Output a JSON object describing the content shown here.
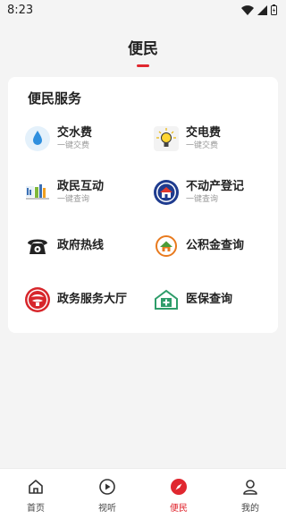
{
  "status_bar": {
    "time": "8:23"
  },
  "header": {
    "title": "便民"
  },
  "card": {
    "title": "便民服务",
    "services": [
      {
        "name": "交水费",
        "sub": "一键交费",
        "icon": "water-drop-icon"
      },
      {
        "name": "交电费",
        "sub": "一键交费",
        "icon": "lightbulb-icon"
      },
      {
        "name": "政民互动",
        "sub": "一键查询",
        "icon": "government-interaction-icon"
      },
      {
        "name": "不动产登记",
        "sub": "一键查询",
        "icon": "real-estate-registration-icon"
      },
      {
        "name": "政府热线",
        "sub": "",
        "icon": "telephone-icon"
      },
      {
        "name": "公积金查询",
        "sub": "",
        "icon": "housing-fund-icon"
      },
      {
        "name": "政务服务大厅",
        "sub": "",
        "icon": "government-service-hall-icon"
      },
      {
        "name": "医保查询",
        "sub": "",
        "icon": "medical-insurance-icon"
      }
    ]
  },
  "tabbar": {
    "items": [
      {
        "label": "首页",
        "icon": "home-icon"
      },
      {
        "label": "视听",
        "icon": "play-icon"
      },
      {
        "label": "便民",
        "icon": "compass-icon",
        "active": true
      },
      {
        "label": "我的",
        "icon": "user-icon"
      }
    ]
  },
  "colors": {
    "accent": "#e0272f",
    "background": "#f4f4f4"
  }
}
